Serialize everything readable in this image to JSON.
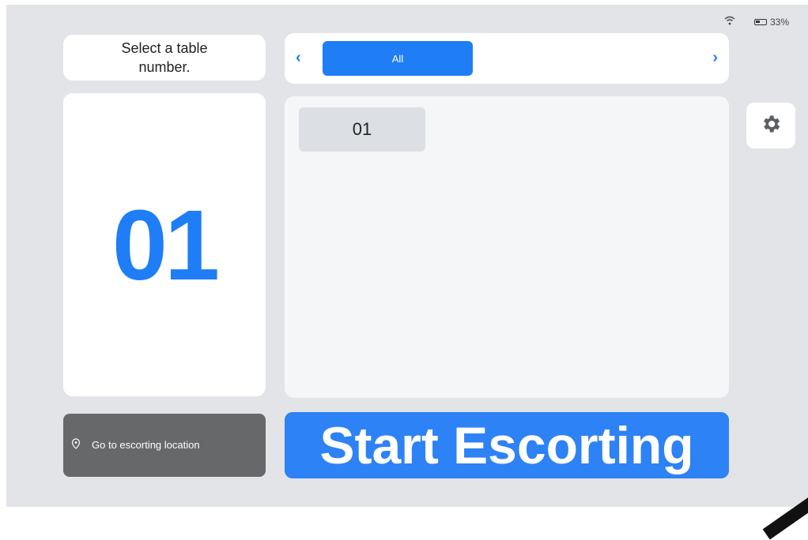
{
  "status_bar": {
    "wifi_icon": "wifi-icon",
    "battery_icon": "battery-icon",
    "battery_percent": "33%"
  },
  "prompt": {
    "text": "Select a table number."
  },
  "filter": {
    "left_icon": "chevron-left-icon",
    "right_icon": "chevron-right-icon",
    "selected_tab": "All"
  },
  "selected_table": "01",
  "tables": [
    "01"
  ],
  "settings_icon": "gear-icon",
  "go_to_location": {
    "icon": "location-pin-icon",
    "label": "Go to escorting location"
  },
  "start_button": {
    "label": "Start Escorting"
  },
  "colors": {
    "accent": "#1f7df6",
    "background": "#e2e4e7",
    "secondary_button": "#666869"
  }
}
